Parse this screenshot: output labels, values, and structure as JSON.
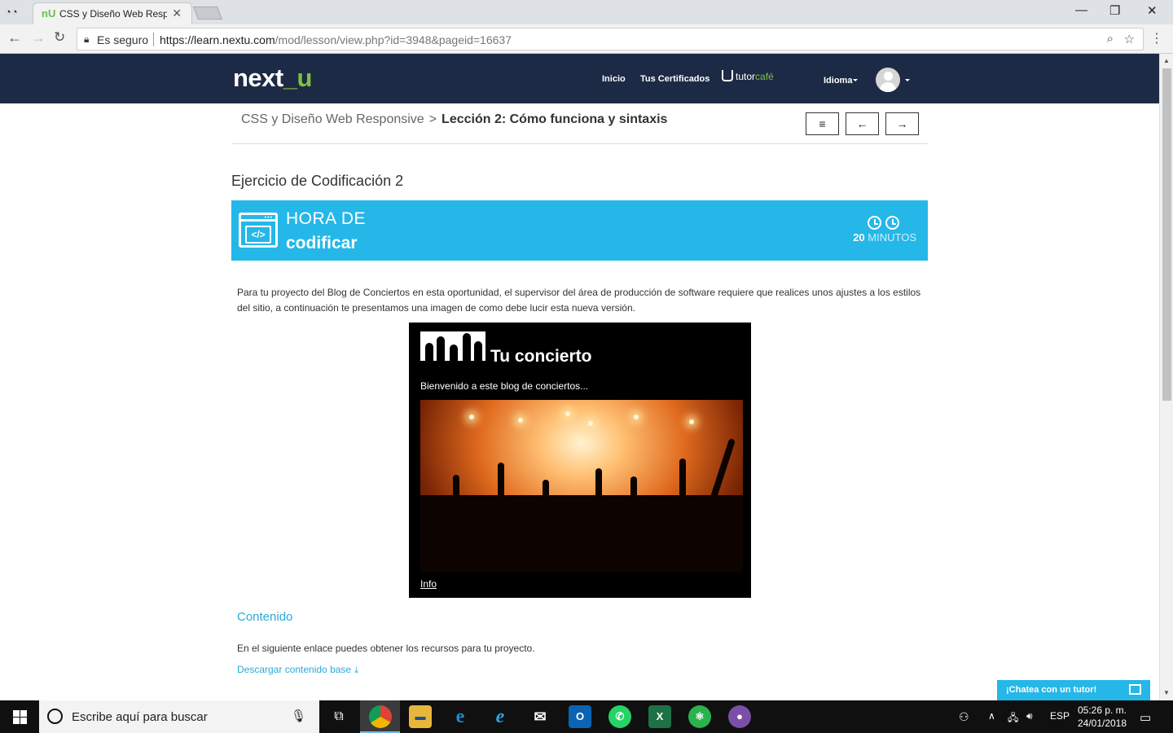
{
  "browser": {
    "tab_title": "CSS y Diseño Web Respo",
    "tab_favicon": "nU",
    "security_label": "Es seguro",
    "url_host": "https://learn.nextu.com",
    "url_path": "/mod/lesson/view.php?id=3948&pageid=16637"
  },
  "header": {
    "logo_main": "next",
    "logo_accent": "_u",
    "nav": [
      "Inicio",
      "Tus Certificados"
    ],
    "tutor_prefix": "tutor",
    "tutor_suffix": "café",
    "language_label": "Idioma"
  },
  "breadcrumb": {
    "course": "CSS y Diseño Web Responsive",
    "separator": ">",
    "lesson": "Lección 2: Cómo funciona y sintaxis"
  },
  "page_nav": {
    "menu": "≡",
    "prev": "←",
    "next": "→"
  },
  "page": {
    "title": "Ejercicio de Codificación 2",
    "banner": {
      "line1": "HORA DE",
      "line2": "codificar",
      "icon_text": "</>",
      "minutes_value": "20",
      "minutes_unit": "MINUTOS"
    },
    "intro": "Para tu proyecto del Blog de Conciertos en esta oportunidad, el supervisor del área de producción de software requiere que realices unos ajustes a los estilos del sitio, a continuación te presentamos una imagen de como debe lucir esta nueva versión.",
    "preview": {
      "title": "Tu concierto",
      "welcome": "Bienvenido a este blog de conciertos...",
      "info_link": "Info"
    },
    "section_heading": "Contenido",
    "resource_text": "En el siguiente enlace puedes obtener los recursos para tu proyecto.",
    "download_link": "Descargar contenido base"
  },
  "chat": {
    "label": "¡Chatea con un tutor!"
  },
  "taskbar": {
    "search_placeholder": "Escribe aquí para buscar",
    "language": "ESP",
    "time": "05:26 p. m.",
    "date": "24/01/2018"
  },
  "colors": {
    "header_bg": "#1d2a45",
    "brand_green": "#7dc142",
    "banner_blue": "#25b7e8",
    "link_blue": "#29a9d9"
  }
}
